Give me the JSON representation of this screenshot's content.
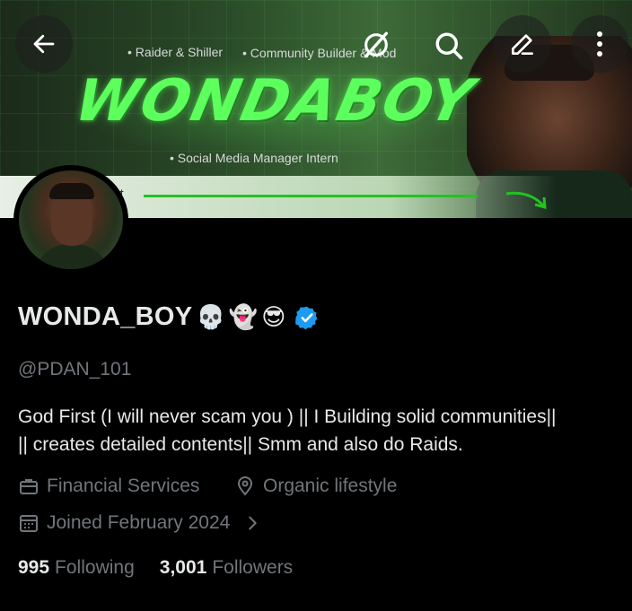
{
  "banner": {
    "tagline_left": "• Raider & Shiller",
    "tagline_right": "• Community Builder & Mod",
    "logo_text": "WONDABOY",
    "tagline_bottom": "• Social Media Manager Intern",
    "strip_text": "ct"
  },
  "toolbar": {
    "back_icon": "arrow-left-icon",
    "grok_icon": "grok-slash-icon",
    "search_icon": "search-icon",
    "edit_icon": "pencil-icon",
    "more_icon": "more-vertical-icon"
  },
  "profile": {
    "display_name": "WONDA_BOY",
    "name_emojis": [
      "💀",
      "👻",
      "😎"
    ],
    "handle": "@PDAN_101",
    "bio_line1": "God First (I will never scam you )  || I Building solid communities||",
    "bio_line2": "|| creates detailed contents|| Smm and also do Raids.",
    "category": "Financial Services",
    "location": "Organic lifestyle",
    "joined": "Joined February 2024",
    "following_count": "995",
    "following_label": "Following",
    "followers_count": "3,001",
    "followers_label": "Followers"
  },
  "colors": {
    "background": "#000000",
    "primary_text": "#e7e9ea",
    "secondary_text": "#71767b",
    "verified_blue": "#1d9bf0",
    "banner_green": "#5dff5d"
  }
}
